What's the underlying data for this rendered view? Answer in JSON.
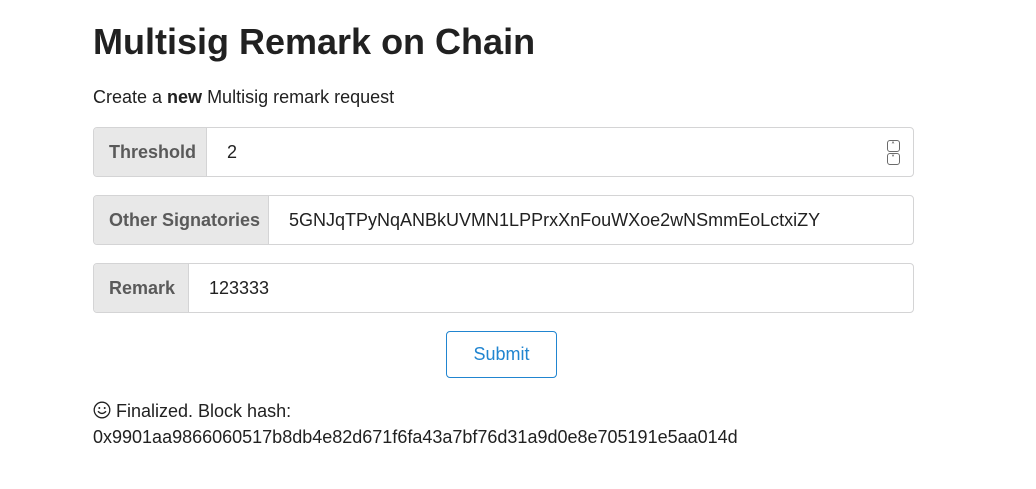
{
  "page": {
    "title": "Multisig Remark on Chain",
    "subtitle_prefix": "Create a ",
    "subtitle_bold": "new",
    "subtitle_suffix": " Multisig remark request"
  },
  "form": {
    "threshold": {
      "label": "Threshold",
      "value": "2"
    },
    "signatories": {
      "label": "Other Signatories",
      "value": "5GNJqTPyNqANBkUVMN1LPPrxXnFouWXoe2wNSmmEoLctxiZY"
    },
    "remark": {
      "label": "Remark",
      "value": "123333"
    },
    "submit_label": "Submit"
  },
  "status": {
    "icon": "smiley-icon",
    "message": "Finalized. Block hash:",
    "block_hash": "0x9901aa9866060517b8db4e82d671f6fa43a7bf76d31a9d0e8e705191e5aa014d"
  },
  "colors": {
    "accent": "#2185d0",
    "label_bg": "#e8e8e8",
    "border": "#d4d4d5"
  }
}
